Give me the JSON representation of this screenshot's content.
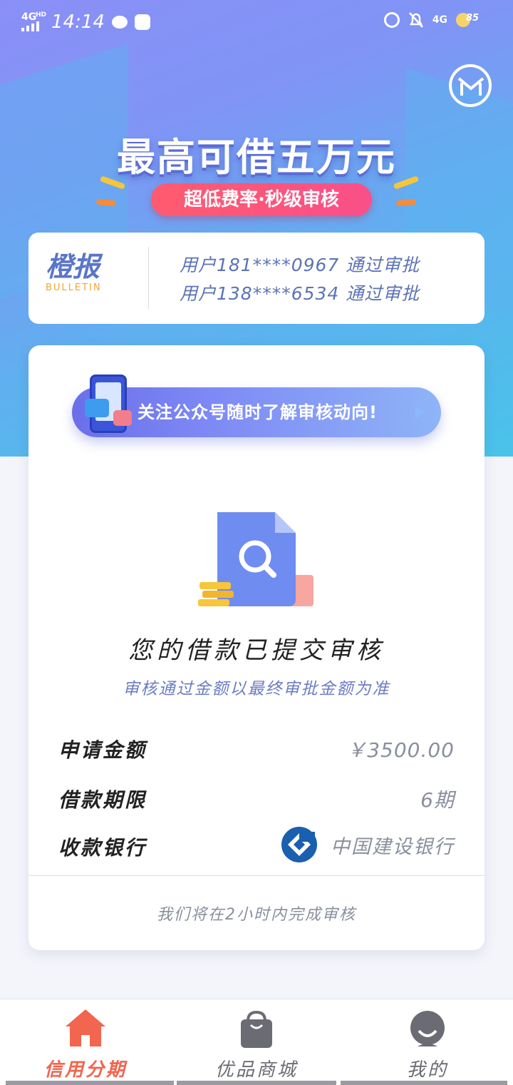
{
  "status_bar": {
    "network": "4G",
    "network_sup": "HD",
    "time": "14:14",
    "right_network": "4G",
    "battery": "85"
  },
  "hero": {
    "headline": "最高可借五万元",
    "tagline": "超低费率·秒级审核"
  },
  "bulletin": {
    "logo_cn": "橙报",
    "logo_en": "BULLETIN",
    "lines": [
      "用户181****0967 通过审批",
      "用户138****6534 通过审批"
    ]
  },
  "card": {
    "banner_text": "关注公众号随时了解审核动向!",
    "title": "您的借款已提交审核",
    "subtitle": "审核通过金额以最终审批金额为准",
    "rows": [
      {
        "label": "申请金额",
        "value": "￥3500.00"
      },
      {
        "label": "借款期限",
        "value": "6期"
      },
      {
        "label": "收款银行",
        "value": "中国建设银行"
      }
    ],
    "footer": "我们将在2小时内完成审核"
  },
  "tabbar": {
    "tabs": [
      {
        "label": "信用分期",
        "icon": "home-icon",
        "active": true
      },
      {
        "label": "优品商城",
        "icon": "shopping-bag-icon",
        "active": false
      },
      {
        "label": "我的",
        "icon": "user-icon",
        "active": false
      }
    ]
  },
  "colors": {
    "accent": "#f2654f",
    "inactive": "#6b6b73",
    "link_blue": "#6b7cc3"
  }
}
